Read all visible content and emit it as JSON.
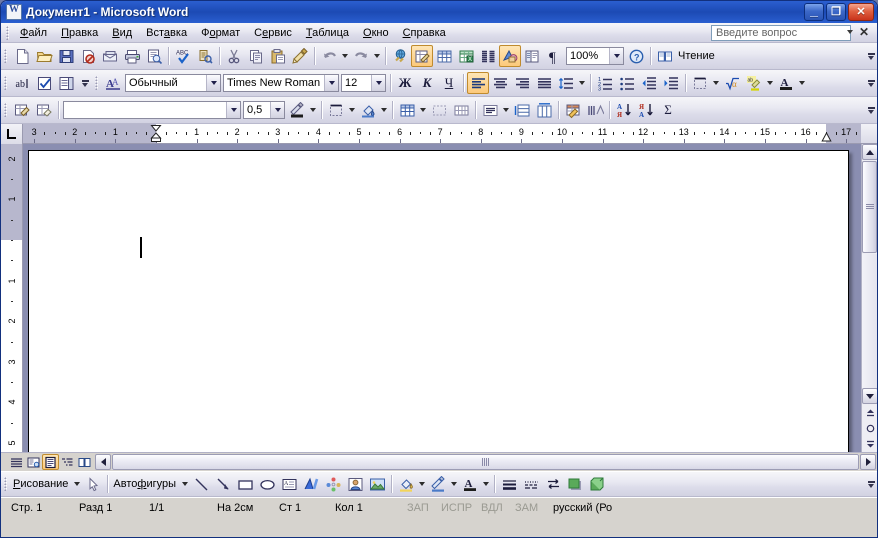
{
  "window": {
    "title": "Документ1 - Microsoft Word",
    "icon": "word-document-icon",
    "minimize_label": "_",
    "maximize_label": "❐",
    "close_label": "✕"
  },
  "menubar": {
    "items": [
      {
        "label": "Файл",
        "accel": "Ф"
      },
      {
        "label": "Правка",
        "accel": "П"
      },
      {
        "label": "Вид",
        "accel": "В"
      },
      {
        "label": "Вставка",
        "accel": "а"
      },
      {
        "label": "Формат",
        "accel": "о"
      },
      {
        "label": "Сервис",
        "accel": "е"
      },
      {
        "label": "Таблица",
        "accel": "Т"
      },
      {
        "label": "Окно",
        "accel": "О"
      },
      {
        "label": "Справка",
        "accel": "С"
      }
    ],
    "ask_box": {
      "placeholder": "Введите вопрос",
      "value": ""
    },
    "close_document_label": "✕"
  },
  "standard_toolbar": {
    "buttons": [
      {
        "name": "new-document-button",
        "title": "Создать"
      },
      {
        "name": "open-button",
        "title": "Открыть"
      },
      {
        "name": "save-button",
        "title": "Сохранить"
      },
      {
        "name": "permission-button",
        "title": "Разрешения"
      },
      {
        "name": "email-button",
        "title": "Сообщение"
      },
      {
        "name": "print-button",
        "title": "Печать"
      },
      {
        "name": "print-preview-button",
        "title": "Предварительный просмотр"
      },
      {
        "name": "spelling-button",
        "title": "Правописание"
      },
      {
        "name": "research-button",
        "title": "Справочные материалы"
      },
      {
        "name": "cut-button",
        "title": "Вырезать"
      },
      {
        "name": "copy-button",
        "title": "Копировать"
      },
      {
        "name": "paste-button",
        "title": "Вставить"
      },
      {
        "name": "format-painter-button",
        "title": "Формат по образцу"
      },
      {
        "name": "undo-button",
        "title": "Отменить"
      },
      {
        "name": "redo-button",
        "title": "Вернуть"
      },
      {
        "name": "hyperlink-button",
        "title": "Гиперссылка"
      },
      {
        "name": "tables-borders-button",
        "title": "Таблицы и границы"
      },
      {
        "name": "insert-table-button",
        "title": "Добавить таблицу"
      },
      {
        "name": "insert-excel-sheet-button",
        "title": "Лист Microsoft Excel"
      },
      {
        "name": "columns-button",
        "title": "Колонки"
      },
      {
        "name": "drawing-button",
        "title": "Рисование"
      },
      {
        "name": "document-map-button",
        "title": "Схема документа"
      },
      {
        "name": "show-formatting-button",
        "title": "Непечатаемые знаки"
      },
      {
        "name": "help-button",
        "title": "Справка"
      }
    ],
    "zoom": {
      "value": "100%",
      "name": "zoom-combo"
    },
    "reading_label": "Чтение"
  },
  "formatting_toolbar": {
    "buttons": [
      {
        "name": "text-box-button",
        "title": "Надпись"
      },
      {
        "name": "check-box-button",
        "title": "Флажок"
      },
      {
        "name": "list-box-button",
        "title": "Поле со списком"
      },
      {
        "name": "styles-formatting-button",
        "title": "Стили и форматирование"
      }
    ],
    "style": {
      "value": "Обычный",
      "name": "style-combo"
    },
    "font": {
      "value": "Times New Roman",
      "name": "font-combo"
    },
    "size": {
      "value": "12",
      "name": "font-size-combo"
    },
    "bold_label": "Ж",
    "italic_label": "К",
    "underline_label": "Ч",
    "align": [
      {
        "name": "align-left-button",
        "active": true
      },
      {
        "name": "align-center-button",
        "active": false
      },
      {
        "name": "align-right-button",
        "active": false
      },
      {
        "name": "align-justify-button",
        "active": false
      }
    ],
    "other": [
      {
        "name": "line-spacing-button"
      },
      {
        "name": "numbered-list-button"
      },
      {
        "name": "bulleted-list-button"
      },
      {
        "name": "decrease-indent-button"
      },
      {
        "name": "increase-indent-button"
      },
      {
        "name": "outside-border-button"
      },
      {
        "name": "equation-button"
      },
      {
        "name": "highlight-color-button"
      },
      {
        "name": "font-color-button"
      }
    ]
  },
  "tables_toolbar": {
    "draw_table_label": "draw-table-icon",
    "eraser_label": "eraser-icon",
    "line_style": {
      "value": "",
      "name": "line-style-combo"
    },
    "line_weight": {
      "value": "0,5",
      "name": "line-weight-combo"
    },
    "buttons": [
      {
        "name": "border-color-button"
      },
      {
        "name": "outside-border-button"
      },
      {
        "name": "shading-color-button"
      },
      {
        "name": "insert-table-button"
      },
      {
        "name": "merge-cells-button"
      },
      {
        "name": "split-cells-button"
      },
      {
        "name": "align-cell-button"
      },
      {
        "name": "distribute-rows-button"
      },
      {
        "name": "distribute-columns-button"
      },
      {
        "name": "table-autoformat-button"
      },
      {
        "name": "change-text-direction-button"
      },
      {
        "name": "sort-ascending-button"
      },
      {
        "name": "sort-descending-button"
      },
      {
        "name": "autosum-button"
      }
    ],
    "sort_asc_label": "А\nЯ",
    "sort_desc_label": "Я\nА",
    "autosum_label": "Σ"
  },
  "ruler": {
    "horizontal_ticks": [
      "3",
      "2",
      "1",
      "1",
      "2",
      "3",
      "4",
      "5",
      "6",
      "7",
      "8",
      "9",
      "10",
      "11",
      "12",
      "13",
      "14",
      "15",
      "16",
      "17"
    ],
    "vertical_ticks": [
      "2",
      "1",
      "1",
      "2",
      "3",
      "4",
      "5"
    ],
    "tab_selector": "left-tab-icon",
    "units": "cm"
  },
  "document": {
    "page_content": "",
    "caret_visible": true
  },
  "view_buttons": [
    {
      "name": "normal-view-button",
      "active": false
    },
    {
      "name": "web-layout-view-button",
      "active": false
    },
    {
      "name": "print-layout-view-button",
      "active": true
    },
    {
      "name": "outline-view-button",
      "active": false
    },
    {
      "name": "reading-layout-view-button",
      "active": false
    }
  ],
  "drawing_toolbar": {
    "draw_label": "Рисование",
    "autoshapes_label": "Автофигуры",
    "buttons": [
      {
        "name": "select-objects-button"
      },
      {
        "name": "line-button"
      },
      {
        "name": "arrow-button"
      },
      {
        "name": "rectangle-button"
      },
      {
        "name": "oval-button"
      },
      {
        "name": "text-box-button"
      },
      {
        "name": "wordart-button"
      },
      {
        "name": "diagram-button"
      },
      {
        "name": "clip-art-button"
      },
      {
        "name": "picture-button"
      },
      {
        "name": "fill-color-button"
      },
      {
        "name": "line-color-button"
      },
      {
        "name": "font-color-button"
      },
      {
        "name": "line-style-button"
      },
      {
        "name": "dash-style-button"
      },
      {
        "name": "arrow-style-button"
      },
      {
        "name": "shadow-style-button"
      },
      {
        "name": "3d-style-button"
      }
    ]
  },
  "status_bar": {
    "page": "Стр. 1",
    "section": "Разд 1",
    "page_of": "1/1",
    "at": "На 2см",
    "line": "Ст 1",
    "column": "Кол 1",
    "rec": "ЗАП",
    "trk": "ИСПР",
    "ext": "ВДЛ",
    "ovr": "ЗАМ",
    "language": "русский (Ро"
  },
  "colors": {
    "titlebar": "#1c4ab4",
    "toolbar_bg": "#e9e9f2",
    "active_button": "#fcc97a",
    "desktop": "#868aad",
    "status_bg": "#d6d3ce"
  }
}
